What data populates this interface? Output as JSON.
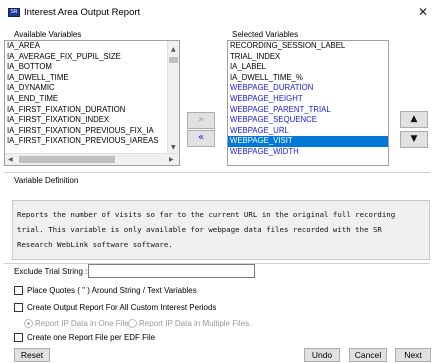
{
  "window": {
    "title": "Interest Area Output Report",
    "icon_text": "SR",
    "close_glyph": "✕"
  },
  "available": {
    "label": "Available Variables",
    "items": [
      "IA_AREA",
      "IA_AVERAGE_FIX_PUPIL_SIZE",
      "IA_BOTTOM",
      "IA_DWELL_TIME",
      "IA_DYNAMIC",
      "IA_END_TIME",
      "IA_FIRST_FIXATION_DURATION",
      "IA_FIRST_FIXATION_INDEX",
      "IA_FIRST_FIXATION_PREVIOUS_FIX_IA",
      "IA_FIRST_FIXATION_PREVIOUS_IAREAS"
    ]
  },
  "selected": {
    "label": "Selected Variables",
    "items": [
      {
        "text": "RECORDING_SESSION_LABEL",
        "style": "normal"
      },
      {
        "text": "TRIAL_INDEX",
        "style": "normal"
      },
      {
        "text": "IA_LABEL",
        "style": "normal"
      },
      {
        "text": "IA_DWELL_TIME_%",
        "style": "normal"
      },
      {
        "text": "WEBPAGE_DURATION",
        "style": "blue"
      },
      {
        "text": "WEBPAGE_HEIGHT",
        "style": "blue"
      },
      {
        "text": "WEBPAGE_PARENT_TRIAL",
        "style": "blue"
      },
      {
        "text": "WEBPAGE_SEQUENCE",
        "style": "blue"
      },
      {
        "text": "WEBPAGE_URL",
        "style": "blue"
      },
      {
        "text": "WEBPAGE_VISIT",
        "style": "selected"
      },
      {
        "text": "WEBPAGE_WIDTH",
        "style": "blue"
      }
    ]
  },
  "move_buttons": {
    "add": "»",
    "remove": "«"
  },
  "order_buttons": {
    "up": "▲",
    "down": "▼"
  },
  "definition": {
    "label": "Variable Definition",
    "lines": [
      "Reports the number of visits so far to the current URL in the original full recording",
      "trial. This variable is only available for webpage data files recorded with the SR",
      "Research WebLink software software."
    ]
  },
  "options": {
    "exclude_label": "Exclude Trial String :",
    "exclude_value": "",
    "place_quotes": "Place Quotes ( \" ) Around String / Text Variables",
    "custom_periods": "Create Output Report For All Custom Interest Periods",
    "radio_one_file": "Report IP Data in One File.",
    "radio_multi_files": "Report IP Data in Multiple Files.",
    "per_edf": "Create one Report File per EDF File"
  },
  "footer": {
    "reset": "Reset",
    "undo": "Undo",
    "cancel": "Cancel",
    "next": "Next"
  },
  "colors": {
    "selection": "#0078d7",
    "blue_text": "#1a1adf"
  }
}
